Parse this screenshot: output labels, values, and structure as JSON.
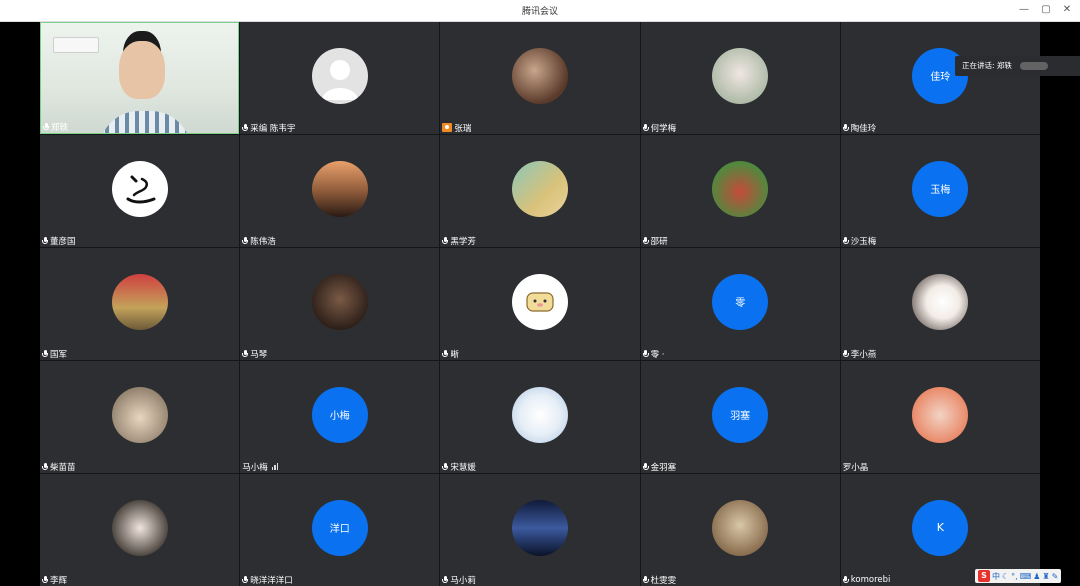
{
  "window": {
    "title": "腾讯会议",
    "controls": [
      "minimize",
      "restore",
      "close"
    ]
  },
  "speaking": {
    "label": "正在讲话: 郑轶"
  },
  "participants": [
    {
      "name": "郑轶",
      "avatar": "camera",
      "icon": "mic-icon"
    },
    {
      "name": "采编 陈韦宇",
      "avatar": "default-person",
      "icon": "mic-icon"
    },
    {
      "name": "张瑞",
      "avatar": "photo",
      "icon": "camera-badge-icon"
    },
    {
      "name": "何学梅",
      "avatar": "photo",
      "icon": "mic-icon"
    },
    {
      "name": "陶佳玲",
      "avatar": "text",
      "avatar_text": "佳玲",
      "icon": "mic-icon"
    },
    {
      "name": "董彦国",
      "avatar": "calligraphy",
      "icon": "mic-icon"
    },
    {
      "name": "陈伟浩",
      "avatar": "photo",
      "icon": "mic-icon"
    },
    {
      "name": "黑学芳",
      "avatar": "photo",
      "icon": "mic-icon"
    },
    {
      "name": "邵研",
      "avatar": "photo",
      "icon": "mic-icon"
    },
    {
      "name": "沙玉梅",
      "avatar": "text",
      "avatar_text": "玉梅",
      "icon": "mic-icon"
    },
    {
      "name": "国军",
      "avatar": "photo",
      "icon": "mic-icon"
    },
    {
      "name": "马琴",
      "avatar": "photo",
      "icon": "mic-icon"
    },
    {
      "name": "晰",
      "avatar": "cartoon",
      "icon": "mic-icon"
    },
    {
      "name": "零 ·",
      "avatar": "text",
      "avatar_text": "零",
      "icon": "mic-icon"
    },
    {
      "name": "李小燕",
      "avatar": "photo",
      "icon": "mic-icon"
    },
    {
      "name": "柴苗苗",
      "avatar": "photo",
      "icon": "mic-icon"
    },
    {
      "name": "马小梅",
      "avatar": "text",
      "avatar_text": "小梅",
      "icon": "signal-icon"
    },
    {
      "name": "宋慧媛",
      "avatar": "photo",
      "icon": "mic-icon"
    },
    {
      "name": "金羽塞",
      "avatar": "text",
      "avatar_text": "羽塞",
      "icon": "mic-icon"
    },
    {
      "name": "罗小晶",
      "avatar": "photo",
      "icon": "none"
    },
    {
      "name": "李辉",
      "avatar": "photo",
      "icon": "mic-icon"
    },
    {
      "name": "晓洋洋洋口",
      "avatar": "text",
      "avatar_text": "洋口",
      "icon": "mic-icon"
    },
    {
      "name": "马小莉",
      "avatar": "photo",
      "icon": "mic-icon"
    },
    {
      "name": "杜雯雯",
      "avatar": "photo",
      "icon": "mic-icon"
    },
    {
      "name": "komorebi",
      "avatar": "text",
      "avatar_text": "K",
      "icon": "mic-icon"
    }
  ],
  "tray": {
    "label": "中"
  },
  "colors": {
    "tile": "#2d2e31",
    "avatar_blue": "#0a72f0",
    "speaking_border": "#7bd08a"
  }
}
